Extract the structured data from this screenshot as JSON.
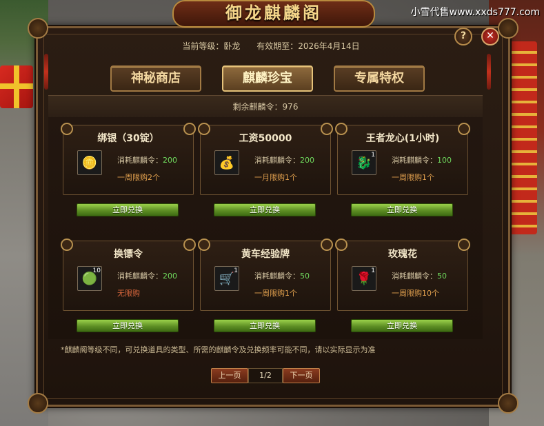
{
  "watermark": "小雪代售www.xxds777.com",
  "window": {
    "title": "御龙麒麟阁",
    "help_label": "?",
    "close_label": "✕"
  },
  "info": {
    "level": "当前等级：卧龙",
    "expiry": "有效期至：2026年4月14日"
  },
  "tabs": [
    {
      "label": "神秘商店",
      "active": false
    },
    {
      "label": "麒麟珍宝",
      "active": true
    },
    {
      "label": "专属特权",
      "active": false
    }
  ],
  "remaining": "剩余麒麟令：976",
  "cost_label": "消耗麒麟令：",
  "exchange_label": "立即兑换",
  "items": [
    {
      "name": "绑银（30锭）",
      "icon": "silver-ingot-icon",
      "glyph": "🪙",
      "count": "",
      "cost": "200",
      "limit": "一周限购2个"
    },
    {
      "name": "工资50000",
      "icon": "gold-pot-icon",
      "glyph": "💰",
      "count": "",
      "cost": "200",
      "limit": "一月限购1个"
    },
    {
      "name": "王者龙心(1小时)",
      "icon": "dragon-heart-icon",
      "glyph": "🐉",
      "count": "1",
      "cost": "100",
      "limit": "一周限购1个"
    },
    {
      "name": "换镖令",
      "icon": "escort-token-icon",
      "glyph": "🟢",
      "count": "10",
      "cost": "200",
      "limit": "无限购"
    },
    {
      "name": "黄车经验牌",
      "icon": "gold-cart-icon",
      "glyph": "🛒",
      "count": "1",
      "cost": "50",
      "limit": "一周限购1个"
    },
    {
      "name": "玫瑰花",
      "icon": "rose-icon",
      "glyph": "🌹",
      "count": "1",
      "cost": "50",
      "limit": "一周限购10个"
    }
  ],
  "note": "*麒麟阁等级不同，可兑换道具的类型、所需的麒麟令及兑换频率可能不同，请以实际显示为准",
  "pager": {
    "prev_label": "上一页",
    "page": "1/2",
    "next_label": "下一页"
  }
}
